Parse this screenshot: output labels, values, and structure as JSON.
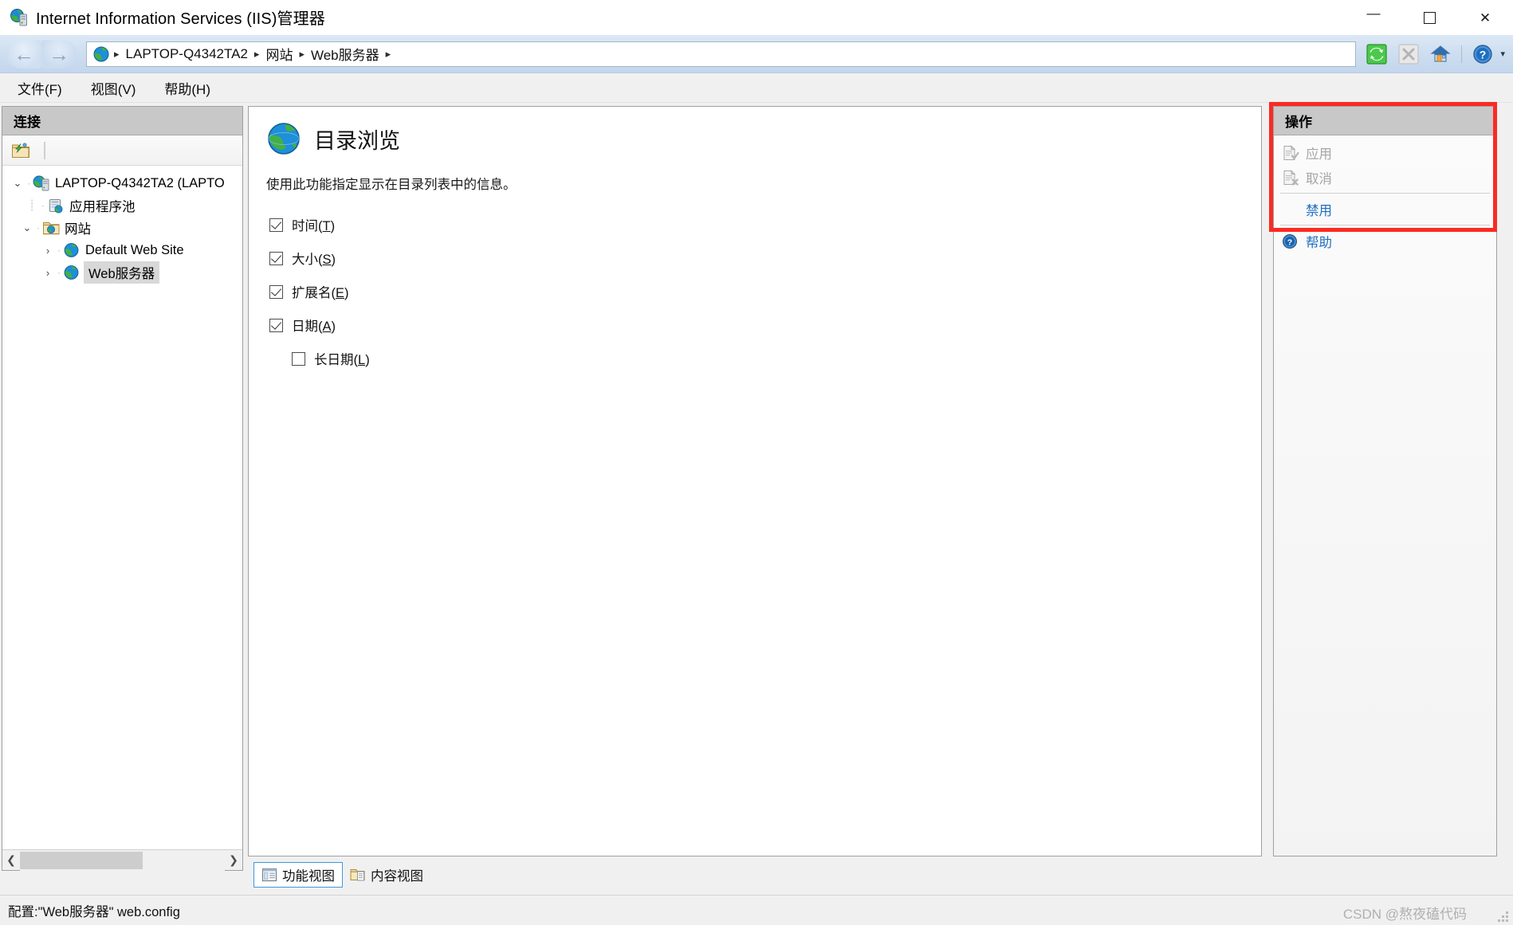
{
  "window": {
    "title": "Internet Information Services (IIS)管理器",
    "icon": "iis-server-globe-icon",
    "minimize_label": "—",
    "maximize_label": "□",
    "close_label": "✕"
  },
  "addressbar": {
    "back_label": "←",
    "forward_label": "→",
    "globe_icon": "globe-icon",
    "separator": "▸",
    "crumbs": [
      {
        "label": "LAPTOP-Q4342TA2"
      },
      {
        "label": "网站"
      },
      {
        "label": "Web服务器"
      }
    ],
    "tools": [
      {
        "name": "refresh-icon",
        "title": "刷新"
      },
      {
        "name": "stop-icon",
        "title": "停止",
        "disabled": true
      },
      {
        "name": "home-icon",
        "title": "主页"
      },
      {
        "name": "help-icon",
        "title": "帮助"
      }
    ],
    "caret": "▾"
  },
  "menubar": {
    "items": [
      {
        "label": "文件(F)"
      },
      {
        "label": "视图(V)"
      },
      {
        "label": "帮助(H)"
      }
    ]
  },
  "connections": {
    "header": "连接",
    "toolbar": [
      {
        "name": "connect-to-server-icon"
      }
    ],
    "tree": [
      {
        "label": "LAPTOP-Q4342TA2 (LAPTO",
        "twisty": "⌄",
        "icon": "server-icon",
        "level": 0,
        "selected": false
      },
      {
        "label": "应用程序池",
        "twisty": "",
        "icon": "app-pool-icon",
        "level": 1,
        "selected": false
      },
      {
        "label": "网站",
        "twisty": "⌄",
        "icon": "sites-folder-icon",
        "level": 1,
        "selected": false
      },
      {
        "label": "Default Web Site",
        "twisty": "›",
        "icon": "website-icon",
        "level": 2,
        "selected": false
      },
      {
        "label": "Web服务器",
        "twisty": "›",
        "icon": "website-icon",
        "level": 2,
        "selected": true
      }
    ],
    "scrollbar": {
      "left_arrow": "❮",
      "right_arrow": "❯",
      "thumb_percent": 60
    }
  },
  "feature": {
    "icon": "directory-browsing-globe-icon",
    "title": "目录浏览",
    "description": "使用此功能指定显示在目录列表中的信息。",
    "checkboxes": [
      {
        "label": "时间",
        "accesskey": "T",
        "checked": true,
        "indent": false
      },
      {
        "label": "大小",
        "accesskey": "S",
        "checked": true,
        "indent": false
      },
      {
        "label": "扩展名",
        "accesskey": "E",
        "checked": true,
        "indent": false
      },
      {
        "label": "日期",
        "accesskey": "A",
        "checked": true,
        "indent": false
      },
      {
        "label": "长日期",
        "accesskey": "L",
        "checked": false,
        "indent": true
      }
    ]
  },
  "view_tabs": [
    {
      "label": "功能视图",
      "icon": "features-view-icon",
      "active": true
    },
    {
      "label": "内容视图",
      "icon": "content-view-icon",
      "active": false
    }
  ],
  "actions": {
    "header": "操作",
    "items": [
      {
        "label": "应用",
        "icon": "apply-icon",
        "state": "disabled"
      },
      {
        "label": "取消",
        "icon": "cancel-icon",
        "state": "disabled"
      },
      {
        "label": "禁用",
        "icon": "",
        "state": "link"
      },
      {
        "label": "帮助",
        "icon": "help-circle-icon",
        "state": "link"
      }
    ]
  },
  "annotation": {
    "color": "#fb2a22",
    "shape": "rectangle"
  },
  "statusbar": {
    "text": "配置:\"Web服务器\" web.config",
    "watermark": "CSDN @熬夜磕代码"
  }
}
